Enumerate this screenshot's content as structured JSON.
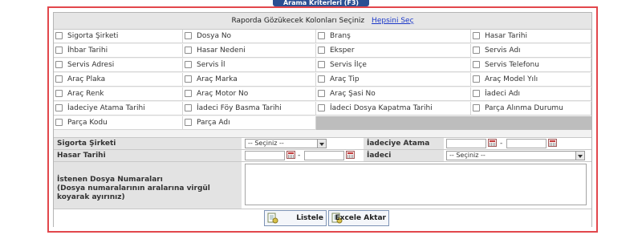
{
  "tab_title": "Arama Kriterleri (F3)",
  "columns_header": {
    "title": "Raporda Gözükecek Kolonları Seçiniz",
    "select_all": "Hepsini Seç"
  },
  "columns": [
    [
      "Sigorta Şirketi",
      "Dosya No",
      "Branş",
      "Hasar Tarihi"
    ],
    [
      "İhbar Tarihi",
      "Hasar Nedeni",
      "Eksper",
      "Servis Adı"
    ],
    [
      "Servis Adresi",
      "Servis İl",
      "Servis İlçe",
      "Servis Telefonu"
    ],
    [
      "Araç Plaka",
      "Araç Marka",
      "Araç Tip",
      "Araç Model Yılı"
    ],
    [
      "Araç Renk",
      "Araç Motor No",
      "Araç Şasi No",
      "İadeci Adı"
    ],
    [
      "İadeciye Atama Tarihi",
      "İadeci Föy Basma Tarihi",
      "İadeci Dosya Kapatma Tarihi",
      "Parça Alınma Durumu"
    ],
    [
      "Parça Kodu",
      "Parça Adı"
    ]
  ],
  "form": {
    "sigorta_label": "Sigorta Şirketi",
    "sigorta_value": "-- Seçiniz --",
    "iadeciye_atama_label": "İadeciye Atama Tarihi",
    "hasar_tarihi_label": "Hasar Tarihi",
    "iadeci_label": "İadeci",
    "iadeci_value": "-- Seçiniz --",
    "dosya_numaralari_label": "İstenen Dosya Numaraları",
    "dosya_numaralari_hint": "(Dosya numaralarının aralarına virgül koyarak ayırınız)",
    "range_separator": "-"
  },
  "buttons": {
    "listele": "Listele",
    "excele_aktar": "Excele Aktar"
  }
}
